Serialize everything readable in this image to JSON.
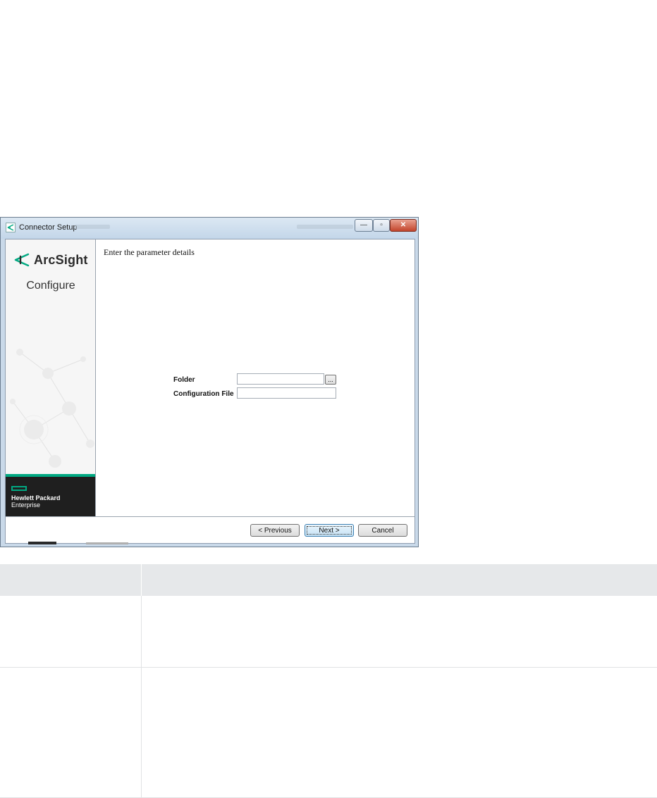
{
  "window": {
    "title": "Connector Setup",
    "minimize_glyph": "—",
    "maximize_glyph": "▫",
    "close_glyph": "✕"
  },
  "sidebar": {
    "logo_text": "ArcSight",
    "step_label": "Configure",
    "brand_line1": "Hewlett Packard",
    "brand_line2": "Enterprise",
    "accent_color": "#01a982"
  },
  "content": {
    "heading": "Enter the parameter details",
    "fields": [
      {
        "label": "Folder",
        "value": "",
        "browse_label": "..."
      },
      {
        "label": "Configuration File",
        "value": ""
      }
    ]
  },
  "footer": {
    "previous_label": "< Previous",
    "next_label": "Next >",
    "cancel_label": "Cancel"
  },
  "table": {
    "headers": [
      "",
      ""
    ],
    "rows": [
      [
        "",
        ""
      ],
      [
        "",
        ""
      ]
    ]
  }
}
